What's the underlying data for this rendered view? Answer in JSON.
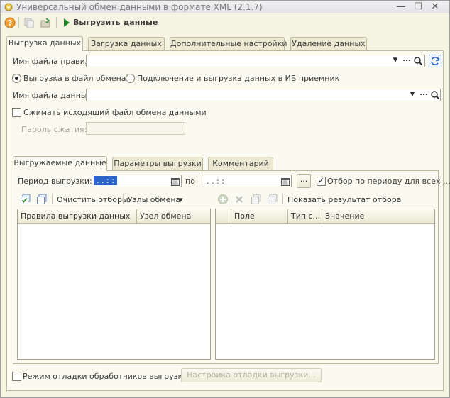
{
  "window": {
    "title": "Универсальный обмен данными в формате XML (2.1.7)",
    "minimize": "—",
    "maximize": "☐",
    "close": "✕"
  },
  "toolbar": {
    "export_label": "Выгрузить данные"
  },
  "main_tabs": [
    "Выгрузка данных",
    "Загрузка данных",
    "Дополнительные настройки",
    "Удаление данных"
  ],
  "export": {
    "rules_file_label": "Имя файла правил:",
    "rules_file_value": "",
    "radio_file": "Выгрузка в файл обмена",
    "radio_ib": "Подключение и выгрузка данных в ИБ приемник",
    "data_file_label": "Имя файла данных:",
    "data_file_value": "",
    "compress_label": "Сжимать исходящий файл обмена данными",
    "password_label": "Пароль сжатия:",
    "password_value": ""
  },
  "sub_tabs": [
    "Выгружаемые данные",
    "Параметры выгрузки",
    "Комментарий"
  ],
  "period": {
    "label": "Период выгрузки:",
    "from_value": ". .   : :",
    "to_label": "по",
    "to_value": ". .   : :",
    "filter_label": "Отбор по периоду для всех ..."
  },
  "left_toolbar": {
    "clear_filters": "Очистить отборы",
    "exchange_nodes": "Узлы обмена"
  },
  "right_toolbar": {
    "show_result": "Показать результат отбора"
  },
  "left_grid": {
    "columns": [
      "Правила выгрузки данных",
      "Узел обмена"
    ]
  },
  "right_grid": {
    "columns": [
      "Поле",
      "Тип с...",
      "Значение"
    ]
  },
  "footer": {
    "debug_label": "Режим отладки обработчиков выгрузки",
    "debug_button": "Настройка отладки выгрузки..."
  },
  "icons": {
    "choice": "▼",
    "dots": "...",
    "dropdown_caret": "▾",
    "check": "✓"
  },
  "colors": {
    "window_bg": "#f5f3e1",
    "panel_bg": "#fbfaf0",
    "selection": "#2c63c7",
    "play_green": "#1f8a1f"
  }
}
